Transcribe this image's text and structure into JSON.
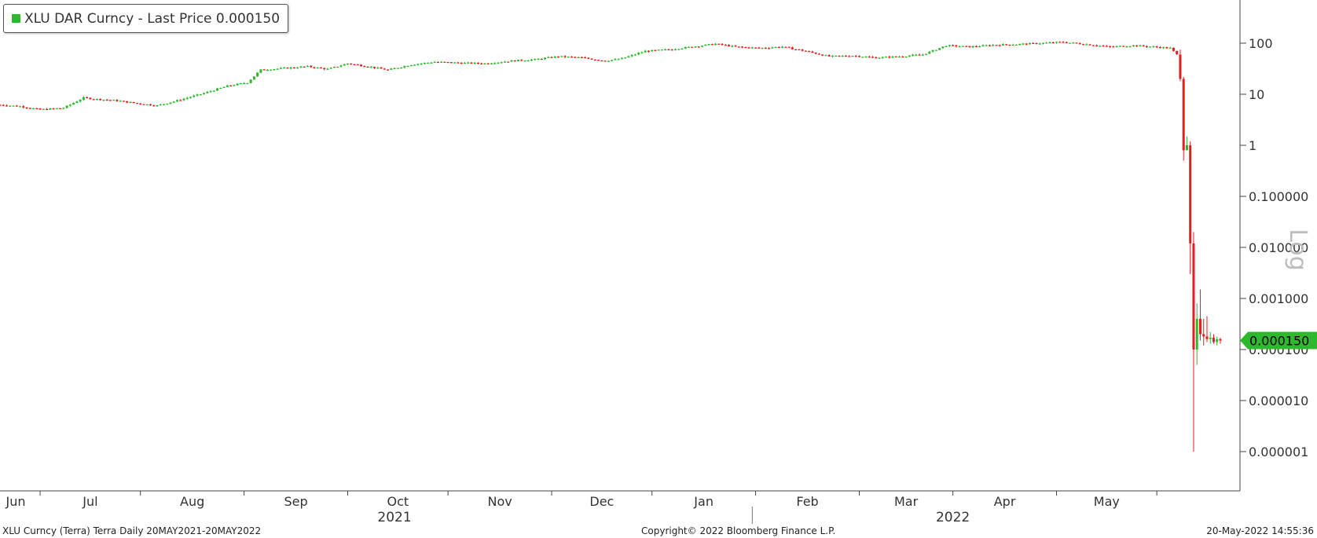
{
  "legend": {
    "label": "XLU DAR Curncy - Last Price 0.000150",
    "color": "#2db82d"
  },
  "footer": {
    "left": "XLU Curncy (Terra) Terra  Daily 20MAY2021-20MAY2022",
    "center": "Copyright© 2022 Bloomberg Finance L.P.",
    "right": "20-May-2022 14:55:36"
  },
  "colors": {
    "up": "#2db82d",
    "down": "#e41e1e",
    "last_price_tag": "#2db82d"
  },
  "chart_data": {
    "type": "candlestick",
    "title": "XLU DAR Curncy - Last Price 0.000150",
    "y_scale": "log",
    "y_scale_label": "Log",
    "ylim": [
      1e-07,
      1000
    ],
    "y_ticks": [
      {
        "value": 100,
        "label": "100"
      },
      {
        "value": 10,
        "label": "10"
      },
      {
        "value": 1,
        "label": "1"
      },
      {
        "value": 0.1,
        "label": "0.100000"
      },
      {
        "value": 0.01,
        "label": "0.010000"
      },
      {
        "value": 0.001,
        "label": "0.001000"
      },
      {
        "value": 0.0001,
        "label": "0.000100"
      },
      {
        "value": 1e-05,
        "label": "0.000010"
      },
      {
        "value": 1e-06,
        "label": "0.000001"
      }
    ],
    "x_range": [
      "2021-05-20",
      "2022-05-20"
    ],
    "x_month_labels": [
      {
        "date": "2021-06-01",
        "label": "Jun"
      },
      {
        "date": "2021-07-01",
        "label": "Jul"
      },
      {
        "date": "2021-08-01",
        "label": "Aug"
      },
      {
        "date": "2021-09-01",
        "label": "Sep"
      },
      {
        "date": "2021-10-01",
        "label": "Oct"
      },
      {
        "date": "2021-11-01",
        "label": "Nov"
      },
      {
        "date": "2021-12-01",
        "label": "Dec"
      },
      {
        "date": "2022-01-01",
        "label": "Jan"
      },
      {
        "date": "2022-02-01",
        "label": "Feb"
      },
      {
        "date": "2022-03-01",
        "label": "Mar"
      },
      {
        "date": "2022-04-01",
        "label": "Apr"
      },
      {
        "date": "2022-05-01",
        "label": "May"
      }
    ],
    "x_year_labels": [
      {
        "date": "2021-09-15",
        "label": "2021"
      },
      {
        "date": "2022-03-01",
        "label": "2022"
      }
    ],
    "year_divider": "2021-12-31",
    "last_price": {
      "value": 0.00015,
      "label": "0.000150"
    },
    "price_path": [
      [
        "2021-05-20",
        6.2
      ],
      [
        "2021-05-26",
        5.8
      ],
      [
        "2021-06-01",
        5.0
      ],
      [
        "2021-06-08",
        5.4
      ],
      [
        "2021-06-14",
        8.5
      ],
      [
        "2021-06-18",
        8.0
      ],
      [
        "2021-06-24",
        7.5
      ],
      [
        "2021-07-01",
        6.5
      ],
      [
        "2021-07-06",
        6.0
      ],
      [
        "2021-07-12",
        7.5
      ],
      [
        "2021-07-20",
        10.5
      ],
      [
        "2021-07-27",
        14.5
      ],
      [
        "2021-08-02",
        17.0
      ],
      [
        "2021-08-06",
        30.0
      ],
      [
        "2021-08-12",
        32.0
      ],
      [
        "2021-08-20",
        35.0
      ],
      [
        "2021-08-26",
        31.0
      ],
      [
        "2021-09-01",
        40.0
      ],
      [
        "2021-09-07",
        35.0
      ],
      [
        "2021-09-13",
        30.0
      ],
      [
        "2021-09-20",
        38.0
      ],
      [
        "2021-09-27",
        43.0
      ],
      [
        "2021-10-05",
        41.0
      ],
      [
        "2021-10-12",
        40.0
      ],
      [
        "2021-10-20",
        45.0
      ],
      [
        "2021-10-27",
        48.0
      ],
      [
        "2021-11-03",
        55.0
      ],
      [
        "2021-11-10",
        52.0
      ],
      [
        "2021-11-17",
        45.0
      ],
      [
        "2021-11-22",
        50.0
      ],
      [
        "2021-11-29",
        70.0
      ],
      [
        "2021-12-06",
        75.0
      ],
      [
        "2021-12-13",
        85.0
      ],
      [
        "2021-12-20",
        97.0
      ],
      [
        "2021-12-26",
        85.0
      ],
      [
        "2022-01-02",
        80.0
      ],
      [
        "2022-01-09",
        85.0
      ],
      [
        "2022-01-16",
        70.0
      ],
      [
        "2022-01-23",
        55.0
      ],
      [
        "2022-01-30",
        57.0
      ],
      [
        "2022-02-06",
        52.0
      ],
      [
        "2022-02-13",
        55.0
      ],
      [
        "2022-02-20",
        60.0
      ],
      [
        "2022-02-27",
        90.0
      ],
      [
        "2022-03-06",
        85.0
      ],
      [
        "2022-03-13",
        92.0
      ],
      [
        "2022-03-20",
        95.0
      ],
      [
        "2022-03-27",
        100.0
      ],
      [
        "2022-04-03",
        105.0
      ],
      [
        "2022-04-10",
        95.0
      ],
      [
        "2022-04-17",
        85.0
      ],
      [
        "2022-04-24",
        90.0
      ],
      [
        "2022-04-30",
        85.0
      ],
      [
        "2022-05-05",
        80.0
      ],
      [
        "2022-05-07",
        60.0
      ]
    ],
    "crash_candles": [
      {
        "date": "2022-05-08",
        "open": 60,
        "high": 75,
        "low": 18,
        "close": 20
      },
      {
        "date": "2022-05-09",
        "open": 20,
        "high": 22,
        "low": 0.5,
        "close": 0.8
      },
      {
        "date": "2022-05-10",
        "open": 0.8,
        "high": 1.5,
        "low": 0.8,
        "close": 1.0
      },
      {
        "date": "2022-05-11",
        "open": 1.0,
        "high": 1.2,
        "low": 0.003,
        "close": 0.012
      },
      {
        "date": "2022-05-12",
        "open": 0.012,
        "high": 0.02,
        "low": 1e-06,
        "close": 0.0001
      },
      {
        "date": "2022-05-13",
        "open": 0.0001,
        "high": 0.0008,
        "low": 5e-05,
        "close": 0.0004
      },
      {
        "date": "2022-05-14",
        "open": 0.0004,
        "high": 0.0015,
        "low": 0.00015,
        "close": 0.0002
      },
      {
        "date": "2022-05-15",
        "open": 0.0002,
        "high": 0.0004,
        "low": 0.00012,
        "close": 0.00018
      },
      {
        "date": "2022-05-16",
        "open": 0.00018,
        "high": 0.00045,
        "low": 0.00014,
        "close": 0.00016
      },
      {
        "date": "2022-05-17",
        "open": 0.00016,
        "high": 0.00022,
        "low": 0.00013,
        "close": 0.00017
      },
      {
        "date": "2022-05-18",
        "open": 0.00017,
        "high": 0.0002,
        "low": 0.00013,
        "close": 0.00014
      },
      {
        "date": "2022-05-19",
        "open": 0.00014,
        "high": 0.00018,
        "low": 0.00012,
        "close": 0.00016
      },
      {
        "date": "2022-05-20",
        "open": 0.00016,
        "high": 0.00017,
        "low": 0.00013,
        "close": 0.00015
      }
    ]
  }
}
